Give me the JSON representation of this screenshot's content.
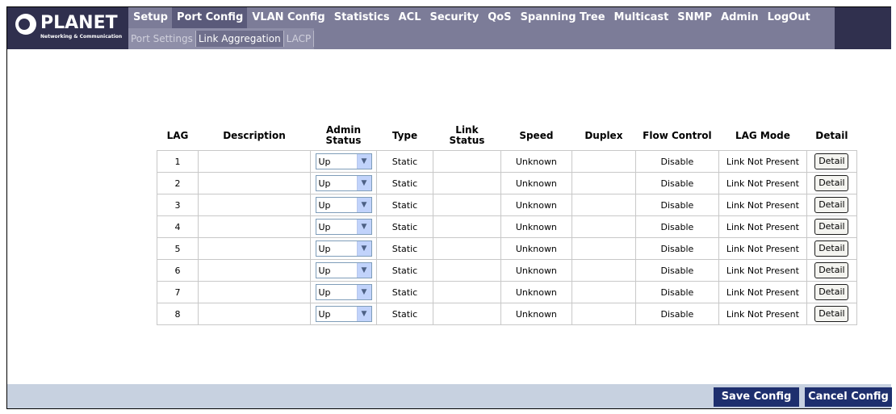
{
  "logo": {
    "brand": "PLANET",
    "tagline": "Networking & Communication"
  },
  "nav": {
    "items": [
      "Setup",
      "Port Config",
      "VLAN Config",
      "Statistics",
      "ACL",
      "Security",
      "QoS",
      "Spanning Tree",
      "Multicast",
      "SNMP",
      "Admin",
      "LogOut"
    ],
    "active": "Port Config"
  },
  "subnav": {
    "items": [
      "Port Settings",
      "Link Aggregation",
      "LACP"
    ],
    "active": "Link Aggregation"
  },
  "table": {
    "headers": [
      "LAG",
      "Description",
      "Admin Status",
      "Type",
      "Link Status",
      "Speed",
      "Duplex",
      "Flow Control",
      "LAG Mode",
      "Detail"
    ],
    "rows": [
      {
        "lag": "1",
        "description": "",
        "admin_status": "Up",
        "type": "Static",
        "link_status": "",
        "speed": "Unknown",
        "duplex": "",
        "flow_control": "Disable",
        "lag_mode": "Link Not Present",
        "detail": "Detail"
      },
      {
        "lag": "2",
        "description": "",
        "admin_status": "Up",
        "type": "Static",
        "link_status": "",
        "speed": "Unknown",
        "duplex": "",
        "flow_control": "Disable",
        "lag_mode": "Link Not Present",
        "detail": "Detail"
      },
      {
        "lag": "3",
        "description": "",
        "admin_status": "Up",
        "type": "Static",
        "link_status": "",
        "speed": "Unknown",
        "duplex": "",
        "flow_control": "Disable",
        "lag_mode": "Link Not Present",
        "detail": "Detail"
      },
      {
        "lag": "4",
        "description": "",
        "admin_status": "Up",
        "type": "Static",
        "link_status": "",
        "speed": "Unknown",
        "duplex": "",
        "flow_control": "Disable",
        "lag_mode": "Link Not Present",
        "detail": "Detail"
      },
      {
        "lag": "5",
        "description": "",
        "admin_status": "Up",
        "type": "Static",
        "link_status": "",
        "speed": "Unknown",
        "duplex": "",
        "flow_control": "Disable",
        "lag_mode": "Link Not Present",
        "detail": "Detail"
      },
      {
        "lag": "6",
        "description": "",
        "admin_status": "Up",
        "type": "Static",
        "link_status": "",
        "speed": "Unknown",
        "duplex": "",
        "flow_control": "Disable",
        "lag_mode": "Link Not Present",
        "detail": "Detail"
      },
      {
        "lag": "7",
        "description": "",
        "admin_status": "Up",
        "type": "Static",
        "link_status": "",
        "speed": "Unknown",
        "duplex": "",
        "flow_control": "Disable",
        "lag_mode": "Link Not Present",
        "detail": "Detail"
      },
      {
        "lag": "8",
        "description": "",
        "admin_status": "Up",
        "type": "Static",
        "link_status": "",
        "speed": "Unknown",
        "duplex": "",
        "flow_control": "Disable",
        "lag_mode": "Link Not Present",
        "detail": "Detail"
      }
    ]
  },
  "footer": {
    "save_label": "Save Config",
    "cancel_label": "Cancel Config"
  },
  "colors": {
    "header_bg": "#30304e",
    "nav_bg": "#7c7c98",
    "button_bg": "#1e2f6e",
    "footer_bg": "#c7d1e0"
  },
  "icons": {
    "dropdown": "chevron-down-icon",
    "logo": "planet-logo-icon"
  }
}
